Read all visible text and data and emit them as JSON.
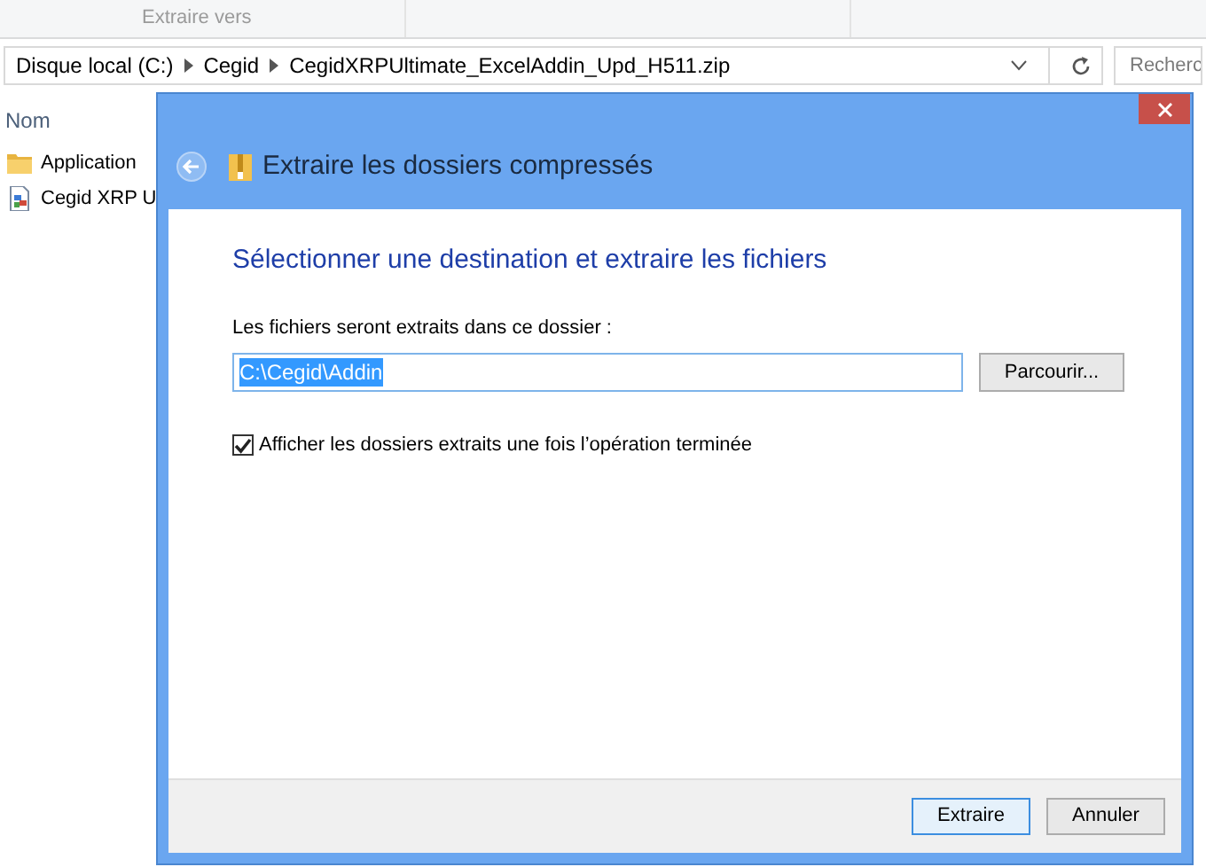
{
  "explorer": {
    "ribbon_label": "Extraire vers",
    "breadcrumb": [
      "Disque local (C:)",
      "Cegid",
      "CegidXRPUltimate_ExcelAddin_Upd_H511.zip"
    ],
    "search_placeholder": "Recherc",
    "column_header": "Nom",
    "files": [
      {
        "name": "Application",
        "kind": "folder"
      },
      {
        "name": "Cegid XRP U",
        "kind": "file"
      }
    ]
  },
  "dialog": {
    "title": "Extraire les dossiers compressés",
    "heading": "Sélectionner une destination et extraire les fichiers",
    "field_label": "Les fichiers seront extraits dans ce dossier :",
    "path": "C:\\Cegid\\Addin",
    "path_selected": true,
    "browse_button": "Parcourir...",
    "show_checkbox": {
      "label": "Afficher les dossiers extraits une fois l’opération terminée",
      "checked": true
    },
    "buttons": [
      {
        "label": "Extraire",
        "default": true
      },
      {
        "label": "Annuler",
        "default": false
      }
    ]
  }
}
